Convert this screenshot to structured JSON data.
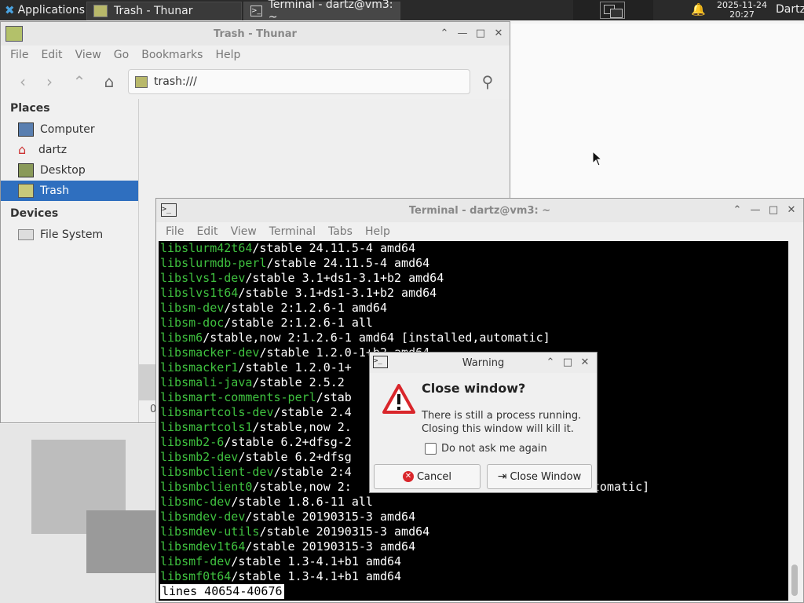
{
  "panel": {
    "applications_label": "Applications",
    "tasks": [
      {
        "label": "Trash - Thunar"
      },
      {
        "label": "Terminal - dartz@vm3: ~"
      }
    ],
    "clock_date": "2025-11-24",
    "clock_time": "20:27",
    "user": "Dartz"
  },
  "thunar": {
    "title": "Trash - Thunar",
    "menu": [
      "File",
      "Edit",
      "View",
      "Go",
      "Bookmarks",
      "Help"
    ],
    "address": "trash:///",
    "places_header": "Places",
    "places": [
      {
        "label": "Computer",
        "icon": "computer-icon"
      },
      {
        "label": "dartz",
        "icon": "home-icon"
      },
      {
        "label": "Desktop",
        "icon": "desktop-icon"
      },
      {
        "label": "Trash",
        "icon": "trash-icon",
        "selected": true
      }
    ],
    "devices_header": "Devices",
    "devices": [
      {
        "label": "File System",
        "icon": "drive-icon"
      }
    ],
    "status_partial": "0"
  },
  "terminal": {
    "title": "Terminal - dartz@vm3: ~",
    "menu": [
      "File",
      "Edit",
      "View",
      "Terminal",
      "Tabs",
      "Help"
    ],
    "lines": [
      {
        "pkg": "libslurm42t64",
        "rest": "/stable 24.11.5-4 amd64"
      },
      {
        "pkg": "libslurmdb-perl",
        "rest": "/stable 24.11.5-4 amd64"
      },
      {
        "pkg": "libslvs1-dev",
        "rest": "/stable 3.1+ds1-3.1+b2 amd64"
      },
      {
        "pkg": "libslvs1t64",
        "rest": "/stable 3.1+ds1-3.1+b2 amd64"
      },
      {
        "pkg": "libsm-dev",
        "rest": "/stable 2:1.2.6-1 amd64"
      },
      {
        "pkg": "libsm-doc",
        "rest": "/stable 2:1.2.6-1 all"
      },
      {
        "pkg": "libsm6",
        "rest": "/stable,now 2:1.2.6-1 amd64 [installed,automatic]"
      },
      {
        "pkg": "libsmacker-dev",
        "rest": "/stable 1.2.0-1+b2 amd64"
      },
      {
        "pkg": "libsmacker1",
        "rest": "/stable 1.2.0-1+"
      },
      {
        "pkg": "libsmali-java",
        "rest": "/stable 2.5.2"
      },
      {
        "pkg": "libsmart-comments-perl",
        "rest": "/stab"
      },
      {
        "pkg": "libsmartcols-dev",
        "rest": "/stable 2.4"
      },
      {
        "pkg": "libsmartcols1",
        "rest": "/stable,now 2."
      },
      {
        "pkg": "libsmb2-6",
        "rest": "/stable 6.2+dfsg-2"
      },
      {
        "pkg": "libsmb2-dev",
        "rest": "/stable 6.2+dfsg"
      },
      {
        "pkg": "libsmbclient-dev",
        "rest": "/stable 2:4"
      },
      {
        "pkg": "libsmbclient0",
        "rest": "/stable,now 2:                      installed,automatic]"
      },
      {
        "pkg": "libsmc-dev",
        "rest": "/stable 1.8.6-11 all"
      },
      {
        "pkg": "libsmdev-dev",
        "rest": "/stable 20190315-3 amd64"
      },
      {
        "pkg": "libsmdev-utils",
        "rest": "/stable 20190315-3 amd64"
      },
      {
        "pkg": "libsmdev1t64",
        "rest": "/stable 20190315-3 amd64"
      },
      {
        "pkg": "libsmf-dev",
        "rest": "/stable 1.3-4.1+b1 amd64"
      },
      {
        "pkg": "libsmf0t64",
        "rest": "/stable 1.3-4.1+b1 amd64"
      }
    ],
    "status": "lines 40654-40676"
  },
  "dialog": {
    "title": "Warning",
    "heading": "Close window?",
    "message_line1": "There is still a process running.",
    "message_line2": "Closing this window will kill it.",
    "checkbox_label": "Do not ask me again",
    "checkbox_checked": false,
    "cancel_label": "Cancel",
    "close_label": "Close Window"
  },
  "colors": {
    "accent": "#2f6fbf",
    "terminal_pkg": "#3fc13f",
    "danger": "#d9262b"
  }
}
